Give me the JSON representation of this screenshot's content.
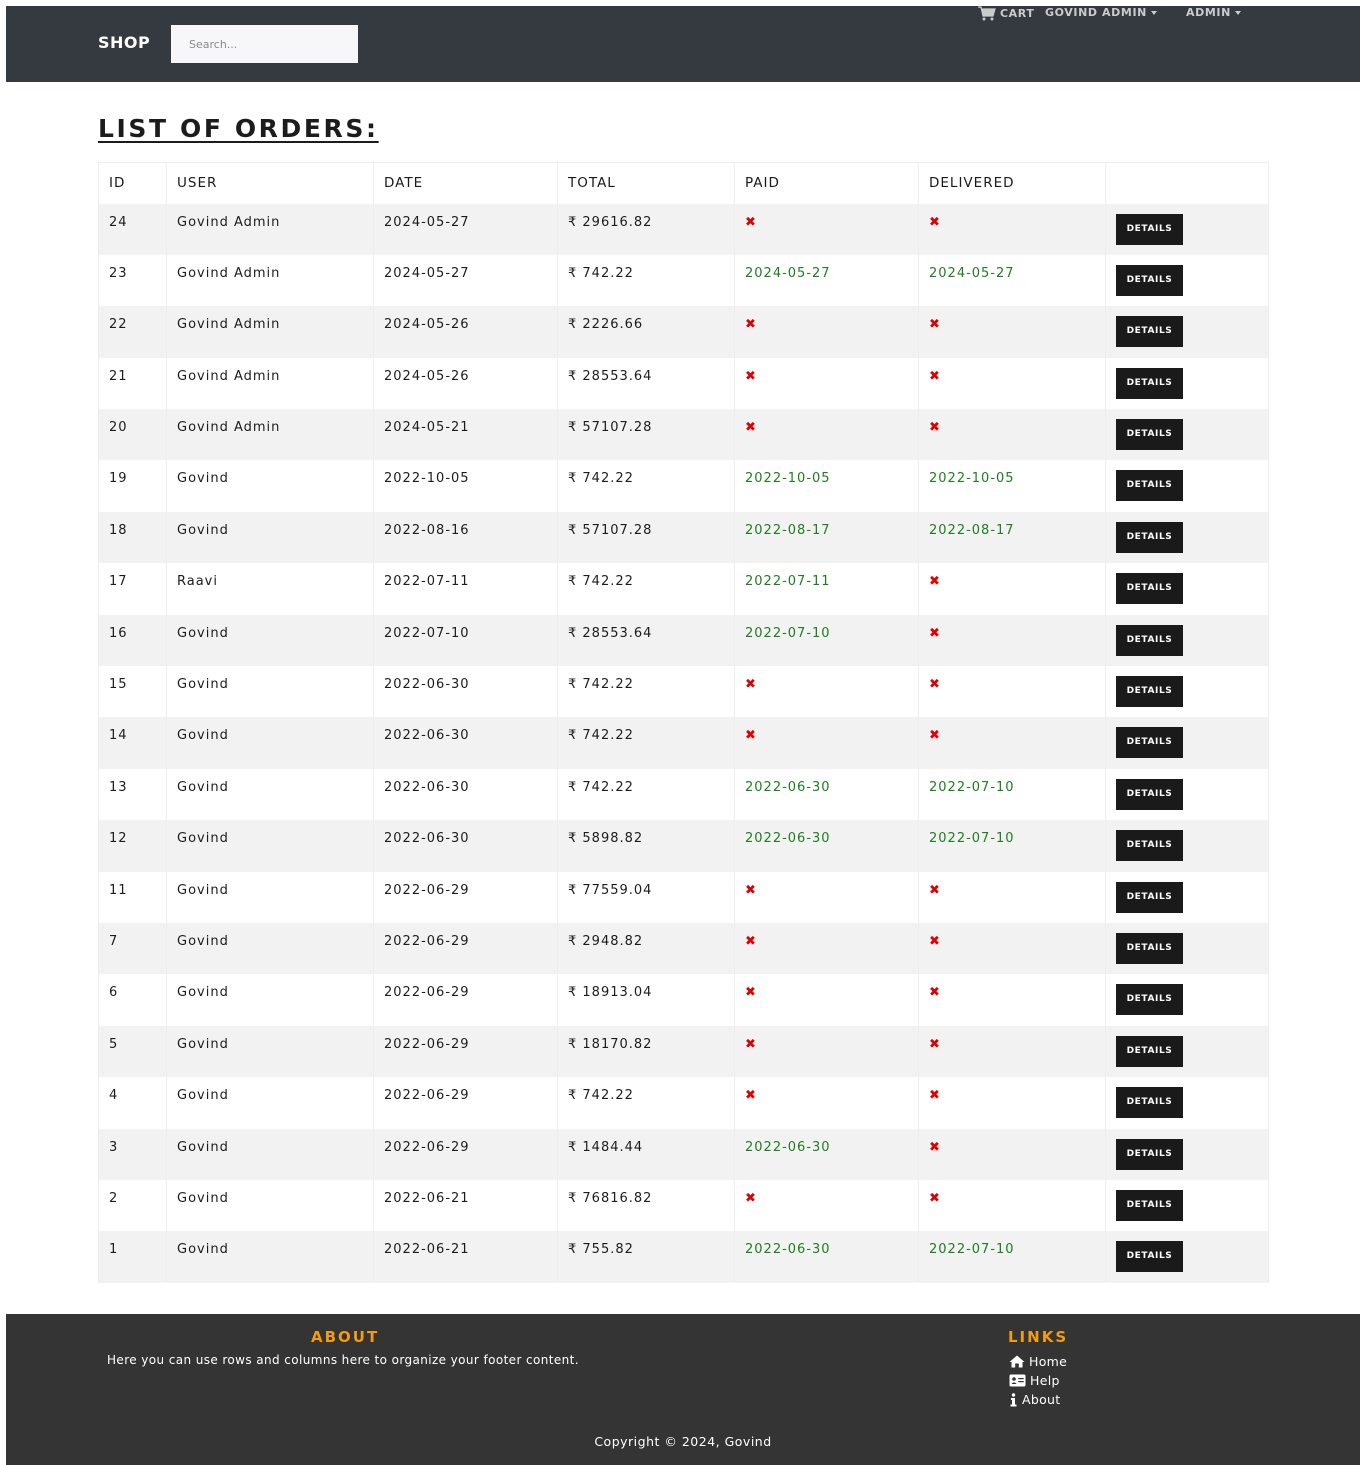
{
  "navbar": {
    "brand": "SHOP",
    "search_placeholder": "Search...",
    "cart_label": "CART",
    "user_label": "GOVIND ADMIN",
    "admin_label": "ADMIN"
  },
  "page": {
    "title": "LIST OF ORDERS:"
  },
  "table": {
    "headers": [
      "ID",
      "USER",
      "DATE",
      "TOTAL",
      "PAID",
      "DELIVERED",
      ""
    ],
    "currency_symbol": "₹",
    "not_done_mark": "✖",
    "details_label": "DETAILS",
    "rows": [
      {
        "id": "24",
        "user": "Govind Admin",
        "date": "2024-05-27",
        "total": "₹ 29616.82",
        "paid": "✖",
        "delivered": "✖"
      },
      {
        "id": "23",
        "user": "Govind Admin",
        "date": "2024-05-27",
        "total": "₹ 742.22",
        "paid": "2024-05-27",
        "delivered": "2024-05-27"
      },
      {
        "id": "22",
        "user": "Govind Admin",
        "date": "2024-05-26",
        "total": "₹ 2226.66",
        "paid": "✖",
        "delivered": "✖"
      },
      {
        "id": "21",
        "user": "Govind Admin",
        "date": "2024-05-26",
        "total": "₹ 28553.64",
        "paid": "✖",
        "delivered": "✖"
      },
      {
        "id": "20",
        "user": "Govind Admin",
        "date": "2024-05-21",
        "total": "₹ 57107.28",
        "paid": "✖",
        "delivered": "✖"
      },
      {
        "id": "19",
        "user": "Govind",
        "date": "2022-10-05",
        "total": "₹ 742.22",
        "paid": "2022-10-05",
        "delivered": "2022-10-05"
      },
      {
        "id": "18",
        "user": "Govind",
        "date": "2022-08-16",
        "total": "₹ 57107.28",
        "paid": "2022-08-17",
        "delivered": "2022-08-17"
      },
      {
        "id": "17",
        "user": "Raavi",
        "date": "2022-07-11",
        "total": "₹ 742.22",
        "paid": "2022-07-11",
        "delivered": "✖"
      },
      {
        "id": "16",
        "user": "Govind",
        "date": "2022-07-10",
        "total": "₹ 28553.64",
        "paid": "2022-07-10",
        "delivered": "✖"
      },
      {
        "id": "15",
        "user": "Govind",
        "date": "2022-06-30",
        "total": "₹ 742.22",
        "paid": "✖",
        "delivered": "✖"
      },
      {
        "id": "14",
        "user": "Govind",
        "date": "2022-06-30",
        "total": "₹ 742.22",
        "paid": "✖",
        "delivered": "✖"
      },
      {
        "id": "13",
        "user": "Govind",
        "date": "2022-06-30",
        "total": "₹ 742.22",
        "paid": "2022-06-30",
        "delivered": "2022-07-10"
      },
      {
        "id": "12",
        "user": "Govind",
        "date": "2022-06-30",
        "total": "₹ 5898.82",
        "paid": "2022-06-30",
        "delivered": "2022-07-10"
      },
      {
        "id": "11",
        "user": "Govind",
        "date": "2022-06-29",
        "total": "₹ 77559.04",
        "paid": "✖",
        "delivered": "✖"
      },
      {
        "id": "7",
        "user": "Govind",
        "date": "2022-06-29",
        "total": "₹ 2948.82",
        "paid": "✖",
        "delivered": "✖"
      },
      {
        "id": "6",
        "user": "Govind",
        "date": "2022-06-29",
        "total": "₹ 18913.04",
        "paid": "✖",
        "delivered": "✖"
      },
      {
        "id": "5",
        "user": "Govind",
        "date": "2022-06-29",
        "total": "₹ 18170.82",
        "paid": "✖",
        "delivered": "✖"
      },
      {
        "id": "4",
        "user": "Govind",
        "date": "2022-06-29",
        "total": "₹ 742.22",
        "paid": "✖",
        "delivered": "✖"
      },
      {
        "id": "3",
        "user": "Govind",
        "date": "2022-06-29",
        "total": "₹ 1484.44",
        "paid": "2022-06-30",
        "delivered": "✖"
      },
      {
        "id": "2",
        "user": "Govind",
        "date": "2022-06-21",
        "total": "₹ 76816.82",
        "paid": "✖",
        "delivered": "✖"
      },
      {
        "id": "1",
        "user": "Govind",
        "date": "2022-06-21",
        "total": "₹ 755.82",
        "paid": "2022-06-30",
        "delivered": "2022-07-10"
      }
    ]
  },
  "footer": {
    "about_title": "ABOUT",
    "about_text": "Here you can use rows and columns here to organize your footer content.",
    "links_title": "LINKS",
    "links": [
      {
        "label": "Home",
        "icon": "home-icon"
      },
      {
        "label": "Help",
        "icon": "id-card-icon"
      },
      {
        "label": "About",
        "icon": "info-icon"
      }
    ],
    "copyright": "Copyright © 2024, Govind"
  },
  "colors": {
    "navbar_bg": "#343a40",
    "footer_bg": "#343434",
    "accent_orange": "#f39c12",
    "status_green": "#1e7e1e",
    "status_red": "#e00000",
    "button_dark": "#1a1a1a",
    "row_stripe": "#f2f2f2"
  }
}
